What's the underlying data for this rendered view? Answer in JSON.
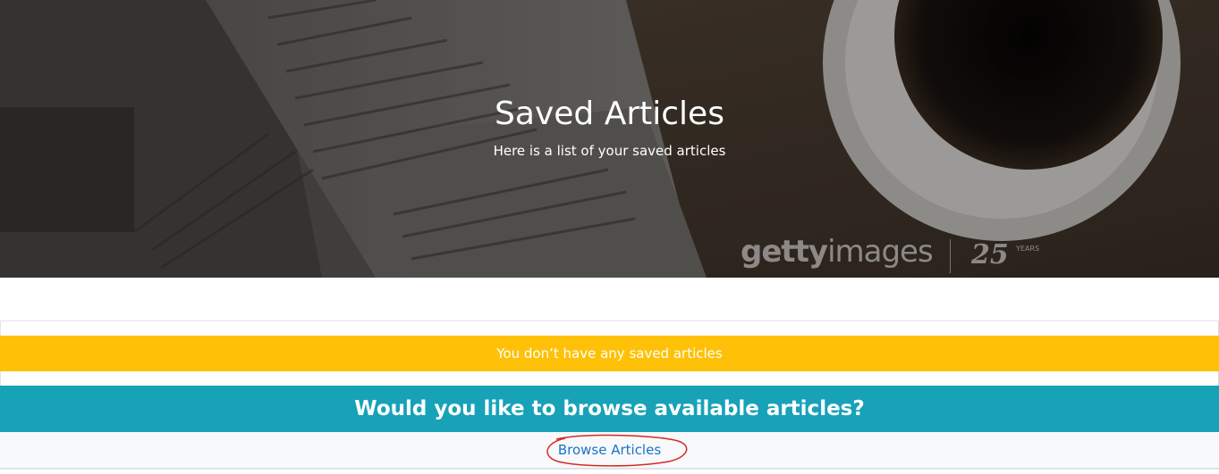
{
  "hero": {
    "title": "Saved Articles",
    "subtitle": "Here is a list of your saved articles",
    "watermark_brand": "getty",
    "watermark_brand_suffix": "images",
    "watermark_anniv": "25",
    "watermark_years": "YEARS"
  },
  "alert": {
    "text": "You don’t have any saved articles",
    "color": "#ffc107"
  },
  "prompt": {
    "text": "Would you like to browse available articles?",
    "color": "#17a2b8"
  },
  "browse": {
    "label": "Browse Articles",
    "color": "#1a73c8"
  },
  "annotation": {
    "color": "#d42a2a"
  }
}
